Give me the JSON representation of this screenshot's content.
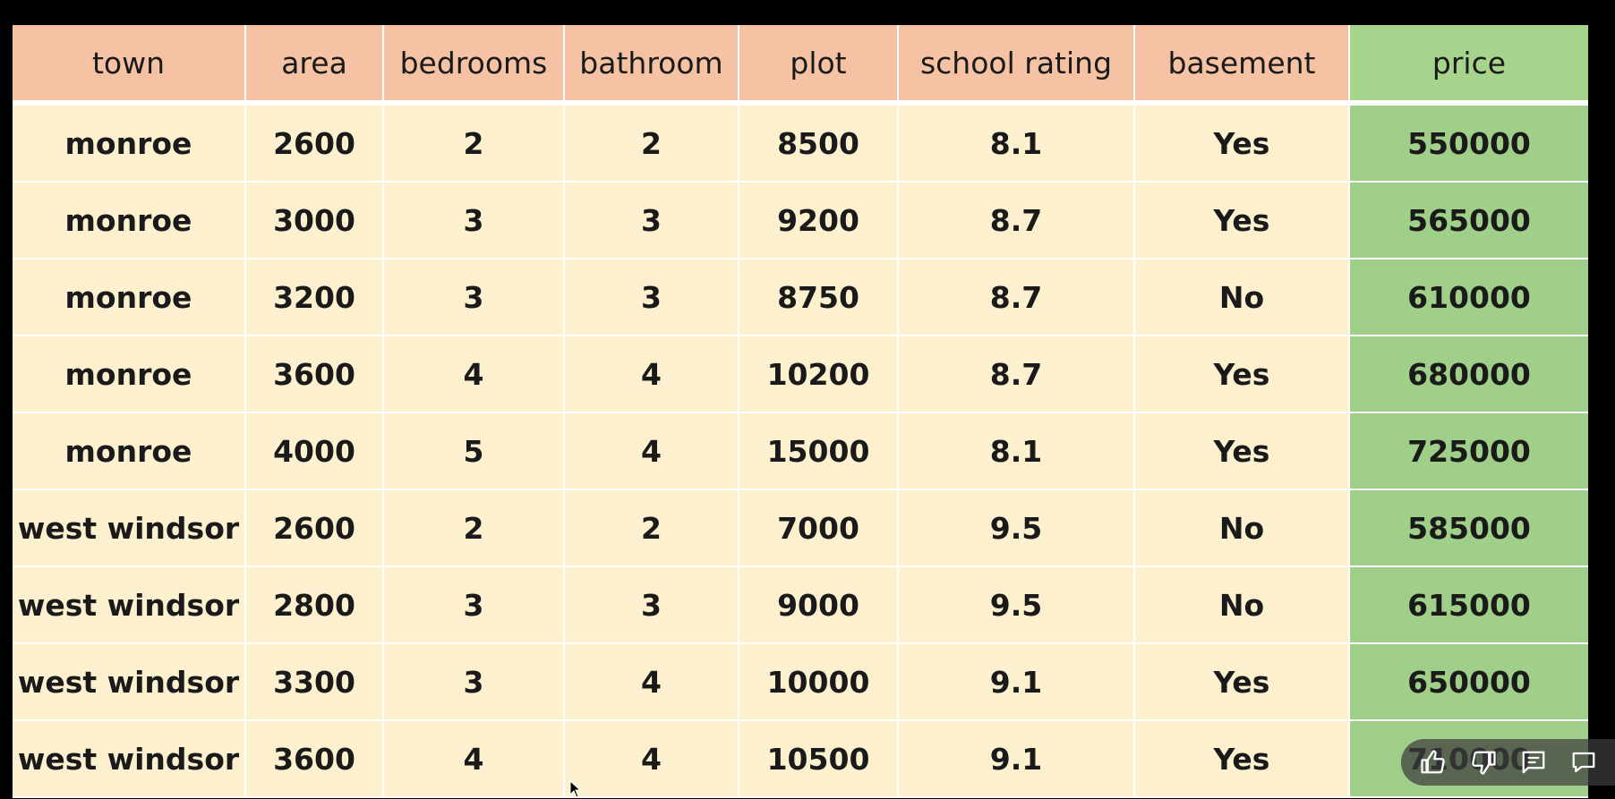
{
  "table": {
    "columns": [
      "town",
      "area",
      "bedrooms",
      "bathroom",
      "plot",
      "school rating",
      "basement",
      "price"
    ],
    "rows": [
      [
        "monroe",
        "2600",
        "2",
        "2",
        "8500",
        "8.1",
        "Yes",
        "550000"
      ],
      [
        "monroe",
        "3000",
        "3",
        "3",
        "9200",
        "8.7",
        "Yes",
        "565000"
      ],
      [
        "monroe",
        "3200",
        "3",
        "3",
        "8750",
        "8.7",
        "No",
        "610000"
      ],
      [
        "monroe",
        "3600",
        "4",
        "4",
        "10200",
        "8.7",
        "Yes",
        "680000"
      ],
      [
        "monroe",
        "4000",
        "5",
        "4",
        "15000",
        "8.1",
        "Yes",
        "725000"
      ],
      [
        "west windsor",
        "2600",
        "2",
        "2",
        "7000",
        "9.5",
        "No",
        "585000"
      ],
      [
        "west windsor",
        "2800",
        "3",
        "3",
        "9000",
        "9.5",
        "No",
        "615000"
      ],
      [
        "west windsor",
        "3300",
        "3",
        "4",
        "10000",
        "9.1",
        "Yes",
        "650000"
      ],
      [
        "west windsor",
        "3600",
        "4",
        "4",
        "10500",
        "9.1",
        "Yes",
        "710000"
      ]
    ]
  },
  "colors": {
    "header_bg": "#f5c3a3",
    "cell_bg": "#fdf0cf",
    "price_bg": "#9fcf88",
    "price_header_bg": "#a7d48c"
  },
  "controls": {
    "icons": [
      "thumbs-up-icon",
      "thumbs-down-icon",
      "comment-icon",
      "chat-icon"
    ]
  }
}
